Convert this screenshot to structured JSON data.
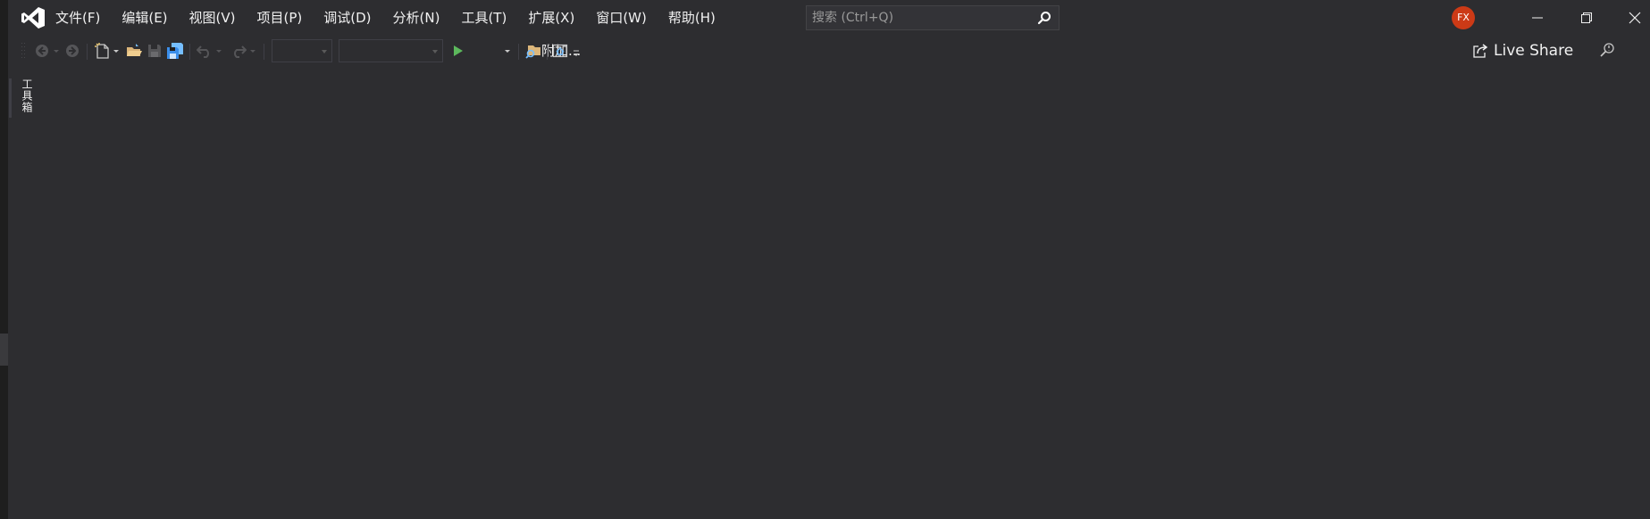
{
  "menu": {
    "items": [
      {
        "label": "文件(F)"
      },
      {
        "label": "编辑(E)"
      },
      {
        "label": "视图(V)"
      },
      {
        "label": "项目(P)"
      },
      {
        "label": "调试(D)"
      },
      {
        "label": "分析(N)"
      },
      {
        "label": "工具(T)"
      },
      {
        "label": "扩展(X)"
      },
      {
        "label": "窗口(W)"
      },
      {
        "label": "帮助(H)"
      }
    ]
  },
  "search": {
    "placeholder": "搜索 (Ctrl+Q)"
  },
  "account": {
    "initials": "FX",
    "color": "#cc3a16"
  },
  "toolbar": {
    "attach_label": "附加...",
    "live_share_label": "Live Share"
  },
  "toolbox": {
    "label": "工具箱"
  },
  "colors": {
    "background": "#2d2d30",
    "accent_green": "#5cb85c",
    "folder": "#dcb67a",
    "save_blue": "#75beff"
  },
  "icons": [
    "vs-logo-icon",
    "search-icon",
    "minimize-icon",
    "restore-icon",
    "close-icon",
    "back-icon",
    "forward-icon",
    "new-project-icon",
    "open-folder-icon",
    "save-icon",
    "save-all-icon",
    "undo-icon",
    "redo-icon",
    "play-icon",
    "solution-explorer-icon",
    "home-icon",
    "live-share-icon",
    "feedback-icon"
  ]
}
